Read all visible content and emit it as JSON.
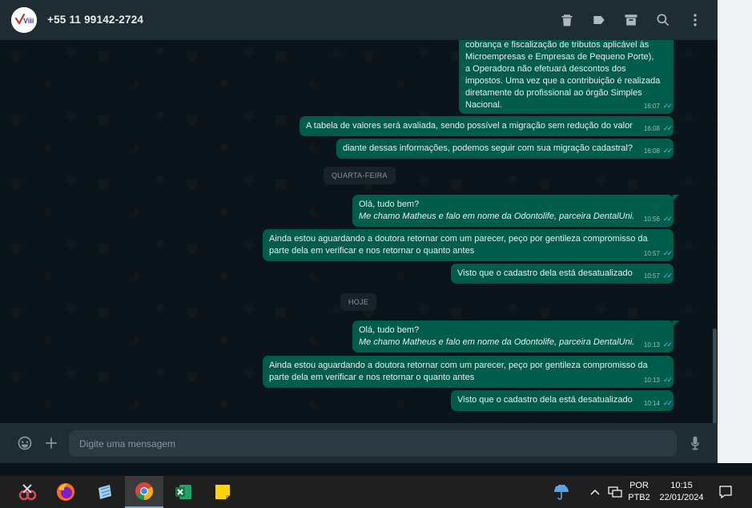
{
  "header": {
    "contact_name": "+55 11 99142-2724",
    "avatar_text": "Viii",
    "icons": [
      "trash-icon",
      "label-icon",
      "archive-icon",
      "search-icon",
      "kebab-menu-icon"
    ]
  },
  "messages": [
    {
      "lines": [
        "cobrança e fiscalização de tributos aplicável às",
        "Microempresas e Empresas de Pequeno Porte),",
        "a Operadora não efetuará descontos dos",
        "impostos. Uma vez que a contribuição é realizada",
        "diretamente do profissional ao órgão Simples",
        "Nacional."
      ],
      "time": "16:07"
    },
    {
      "lines": [
        "A tabela de valores será avaliada, sendo possível a migração sem redução do valor"
      ],
      "time": "16:08"
    },
    {
      "lines": [
        "diante dessas informações, podemos seguir com sua migração cadastral?"
      ],
      "time": "16:08"
    },
    {
      "lines": [
        "Olá, tudo bem?",
        "Me chamo Matheus e falo em nome da Odontolife, parceira DentalUni."
      ],
      "time": "10:56"
    },
    {
      "lines": [
        "Ainda estou aguardando a doutora retornar com um parecer, peço por gentileza compromisso da",
        "parte dela em verificar e nos retornar o quanto antes"
      ],
      "time": "10:57"
    },
    {
      "lines": [
        "Visto que o cadastro dela está desatualizado"
      ],
      "time": "10:57"
    },
    {
      "lines": [
        "Olá, tudo bem?",
        "Me chamo Matheus e falo em nome da Odontolife, parceira DentalUni."
      ],
      "time": "10:13"
    },
    {
      "lines": [
        "Ainda estou aguardando a doutora retornar com um parecer, peço por gentileza compromisso da",
        "parte dela em verificar e nos retornar o quanto antes"
      ],
      "time": "10:13"
    },
    {
      "lines": [
        "Visto que o cadastro dela está desatualizado"
      ],
      "time": "10:14"
    }
  ],
  "day_separators": [
    "QUARTA-FEIRA",
    "HOJE"
  ],
  "composer": {
    "placeholder": "Digite uma mensagem"
  },
  "taskbar": {
    "apps": [
      "snipping-tool",
      "firefox",
      "notepad",
      "chrome",
      "excel",
      "sticky-notes"
    ],
    "active_app": "chrome",
    "language": "POR",
    "layout": "PTB2",
    "time": "10:15",
    "date": "22/01/2024"
  },
  "colors": {
    "outgoing_bubble": "#005c4b",
    "chat_bg": "#0b141a",
    "header_bg": "#202c33",
    "read_ticks": "#53bdeb"
  }
}
